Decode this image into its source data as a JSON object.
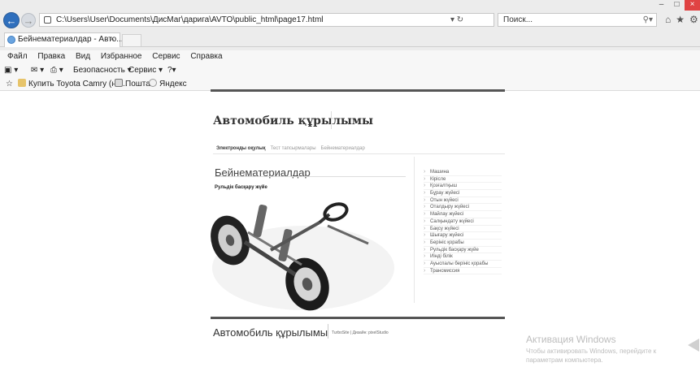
{
  "browser": {
    "address_url": "C:\\Users\\User\\Documents\\ДисМаг\\дарига\\AVTO\\public_html\\page17.html",
    "search_placeholder": "Поиск...",
    "tab_title": "Бейнематериалдар - Авто...",
    "tab_close": "×",
    "menu": [
      "Файл",
      "Правка",
      "Вид",
      "Избранное",
      "Сервис",
      "Справка"
    ],
    "command_bar": {
      "safety": "Безопасность ▾",
      "service": "Сервис ▾",
      "help": "?▾"
    },
    "favorites": [
      {
        "label": "Купить Toyota Camry (но...",
        "icon": "link-icon"
      },
      {
        "label": "Пошта",
        "icon": "mail-icon"
      },
      {
        "label": "Яндекс",
        "icon": "yandex-icon"
      }
    ],
    "address_tools": "▾ ↻",
    "window_controls": {
      "minimize": "–",
      "maximize": "□",
      "close": "×"
    },
    "right_icons": {
      "home": "⌂",
      "favorites": "★",
      "settings": "⚙"
    }
  },
  "page": {
    "site_title": "Автомобиль құрылымы",
    "nav_tabs": [
      {
        "label": "Электронды оқулық",
        "active": true
      },
      {
        "label": "Тест тапсырмалары",
        "active": false
      },
      {
        "label": "Бейнематериалдар",
        "active": false
      }
    ],
    "section_title": "Бейнематериалдар",
    "sub_heading": "Рульдік басқару жүйе",
    "side_menu": [
      "Машина",
      "Кірісле",
      "Қозғалтқыш",
      "Бұрау жүйесі",
      "Отын жүйесі",
      "Оталдыру жүйесі",
      "Майлау жүйесі",
      "Салқындату жүйесі",
      "Бақсу жүйесі",
      "Шығару жүйесі",
      "Берініс қорабы",
      "Рульдік басқару жүйе",
      "Иінді білік",
      "Ауыспалы берініс қорабы",
      "Трансмиссия"
    ],
    "footer_title": "Автомобиль құрылымы",
    "footer_credit": "TurboSite | Дизайн: pixelStudio"
  },
  "watermark": {
    "title": "Активация Windows",
    "text": "Чтобы активировать Windows, перейдите к параметрам компьютера."
  },
  "colors": {
    "accent_back": "#2f6fbd",
    "page_rule": "#555555",
    "close_button": "#e04343"
  }
}
